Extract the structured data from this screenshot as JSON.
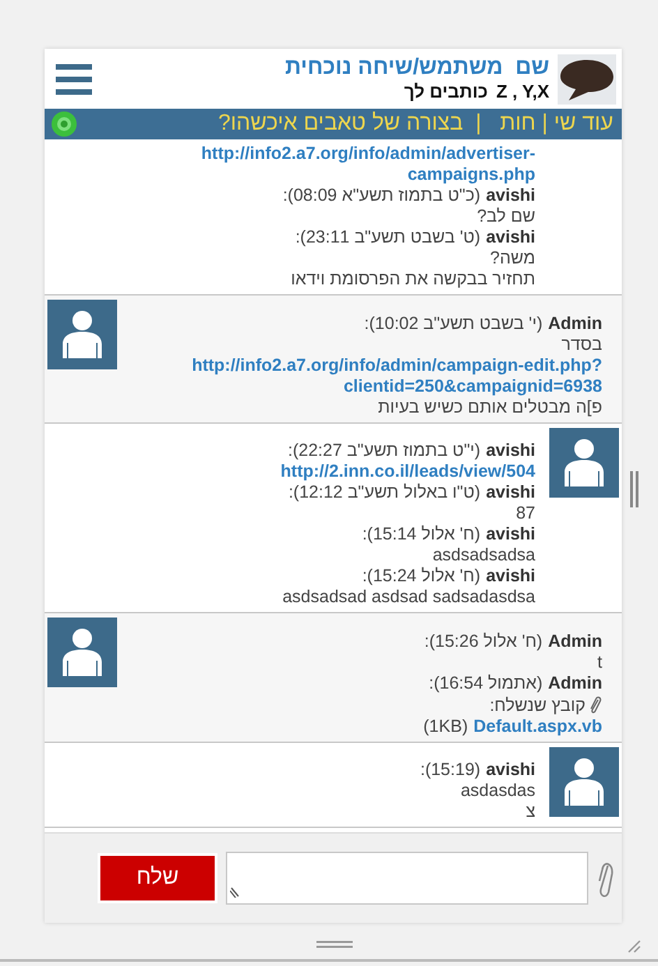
{
  "header": {
    "title": "שם  משתמש/שיחה נוכחית",
    "names": "Z , Y,X",
    "subtitle": "כותבים לך"
  },
  "tab_bar": {
    "text": "עוד שי | חות   |  בצורה של טאבים איכשהו?"
  },
  "groups": [
    {
      "kind": "right",
      "avatar": false,
      "items": [
        {
          "kind": "link",
          "text": "http://info2.a7.org/info/admin/advertiser-campaigns.php"
        },
        {
          "kind": "header",
          "author": "avishi",
          "meta": "(כ\"ט בתמוז תשע\"א 08:09):"
        },
        {
          "kind": "text",
          "text": "שם לב?"
        },
        {
          "kind": "header",
          "author": "avishi",
          "meta": "(ט' בשבט תשע\"ב 23:11):"
        },
        {
          "kind": "text",
          "text": "משה?"
        },
        {
          "kind": "text",
          "text": "תחזיר בבקשה את הפרסומת וידאו"
        }
      ]
    },
    {
      "kind": "left",
      "avatar": true,
      "items": [
        {
          "kind": "header",
          "author": "Admin",
          "meta": "(י' בשבט תשע\"ב 10:02):"
        },
        {
          "kind": "text",
          "text": "בסדר"
        },
        {
          "kind": "link",
          "text": "http://info2.a7.org/info/admin/campaign-edit.php?clientid=250&campaignid=6938"
        },
        {
          "kind": "text",
          "text": "פ]ה מבטלים אותם כשיש בעיות"
        }
      ]
    },
    {
      "kind": "right",
      "avatar": true,
      "items": [
        {
          "kind": "header",
          "author": "avishi",
          "meta": "(י\"ט בתמוז תשע\"ב 22:27):"
        },
        {
          "kind": "link",
          "text": "http://2.inn.co.il/leads/view/504"
        },
        {
          "kind": "header",
          "author": "avishi",
          "meta": "(ט\"ו באלול תשע\"ב 12:12):"
        },
        {
          "kind": "text",
          "text": "87"
        },
        {
          "kind": "header",
          "author": "avishi",
          "meta": "(ח' אלול 15:14):"
        },
        {
          "kind": "text",
          "text": "asdsadsadsa"
        },
        {
          "kind": "header",
          "author": "avishi",
          "meta": "(ח' אלול 15:24):"
        },
        {
          "kind": "text",
          "text": "asdsadsad asdsad sadsadasdsa"
        }
      ]
    },
    {
      "kind": "left",
      "avatar": true,
      "items": [
        {
          "kind": "header",
          "author": "Admin",
          "meta": "(ח' אלול 15:26):"
        },
        {
          "kind": "text",
          "text": "t"
        },
        {
          "kind": "header",
          "author": "Admin",
          "meta": "(אתמול 16:54):"
        },
        {
          "kind": "attachment",
          "text": "קובץ שנשלח:"
        },
        {
          "kind": "file",
          "name": "Default.aspx.vb",
          "size": "(1KB)"
        }
      ]
    },
    {
      "kind": "right",
      "avatar": true,
      "items": [
        {
          "kind": "header",
          "author": "avishi",
          "meta": "(15:19):"
        },
        {
          "kind": "text",
          "text": "asdasdas"
        },
        {
          "kind": "text",
          "text": "צ"
        }
      ]
    }
  ],
  "composer": {
    "send_label": "שלח"
  }
}
